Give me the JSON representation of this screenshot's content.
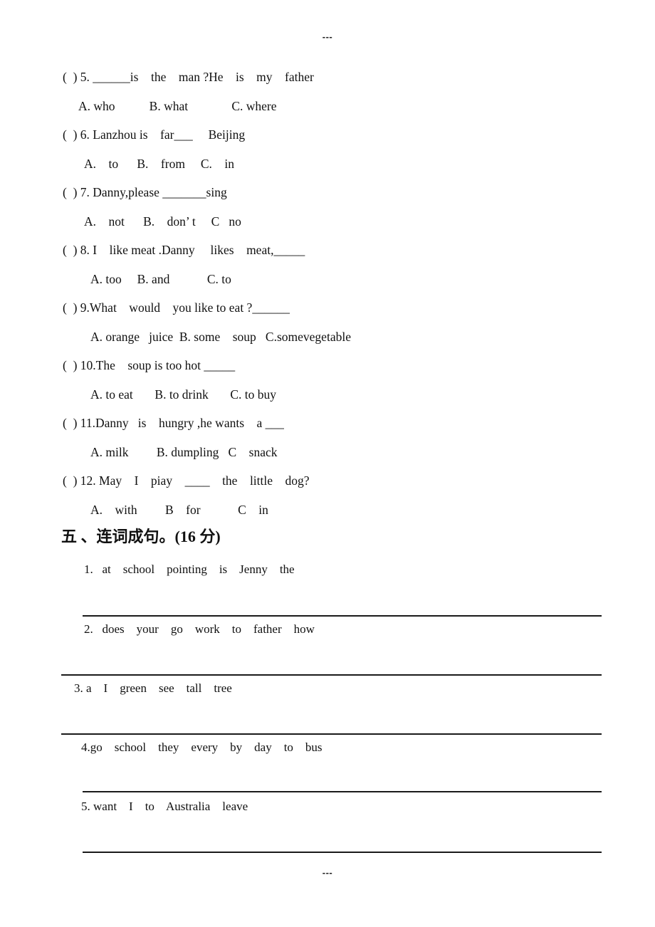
{
  "page": {
    "top_mark": "---",
    "bottom_mark": "---"
  },
  "multiple_choice": {
    "items": [
      {
        "number": "5",
        "question": "(  ) 5. ______is    the    man ?He    is    my    father",
        "options": "A. who           B. what              C. where"
      },
      {
        "number": "6",
        "question": "(  ) 6. Lanzhou is    far___     Beijing",
        "options": "A.    to      B.    from     C.    in"
      },
      {
        "number": "7",
        "question": "(  ) 7. Danny,please _______sing",
        "options": "A.    not      B.    don’ t     C   no"
      },
      {
        "number": "8",
        "question": "(  ) 8. I    like meat .Danny     likes    meat,_____",
        "options": "A. too     B. and            C. to"
      },
      {
        "number": "9",
        "question": "(  ) 9.What    would    you like to eat ?______",
        "options": "A. orange   juice  B. some    soup   C.somevegetable"
      },
      {
        "number": "10",
        "question": "(  ) 10.The    soup is too hot _____",
        "options": "A. to eat       B. to drink       C. to buy"
      },
      {
        "number": "11",
        "question": "(  ) 11.Danny   is    hungry ,he wants    a ___",
        "options": "A. milk         B. dumpling   C    snack"
      },
      {
        "number": "12",
        "question": "(  ) 12. May    I    piay    ____    the    little    dog?",
        "options": "A.    with         B    for            C    in"
      }
    ]
  },
  "section_five": {
    "heading": "五 、连词成句。(16 分)",
    "items": [
      {
        "number": "1",
        "text": "1.   at    school    pointing    is    Jenny    the"
      },
      {
        "number": "2",
        "text": "2.   does    your    go    work    to    father    how"
      },
      {
        "number": "3",
        "text": "3. a    I    green    see    tall    tree"
      },
      {
        "number": "4",
        "text": "4.go    school    they    every    by    day    to    bus"
      },
      {
        "number": "5",
        "text": "5. want    I    to    Australia    leave"
      }
    ]
  }
}
